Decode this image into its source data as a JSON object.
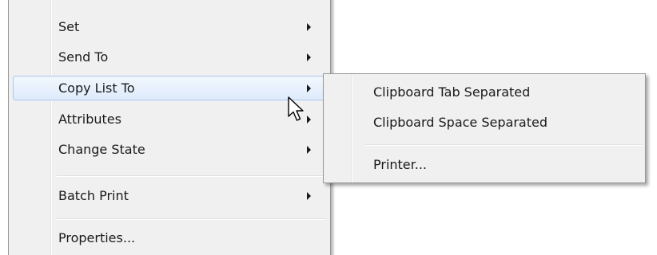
{
  "context_menu": {
    "items": [
      {
        "label": "Set",
        "has_submenu": true
      },
      {
        "label": "Send To",
        "has_submenu": true
      },
      {
        "label": "Copy List To",
        "has_submenu": true,
        "highlighted": true
      },
      {
        "label": "Attributes",
        "has_submenu": true
      },
      {
        "label": "Change State",
        "has_submenu": true
      },
      {
        "label": "Batch Print",
        "has_submenu": true
      },
      {
        "label": "Properties...",
        "has_submenu": false
      }
    ]
  },
  "submenu": {
    "items": [
      {
        "label": "Clipboard Tab Separated"
      },
      {
        "label": "Clipboard Space Separated"
      },
      {
        "label": "Printer..."
      }
    ]
  },
  "icons": {
    "submenu_arrow": "triangle-right-icon",
    "cursor": "mouse-pointer-icon"
  },
  "colors": {
    "menu_background": "#f0f0f0",
    "highlight_border": "#a9c8f0",
    "highlight_fill": "#deebfb"
  }
}
